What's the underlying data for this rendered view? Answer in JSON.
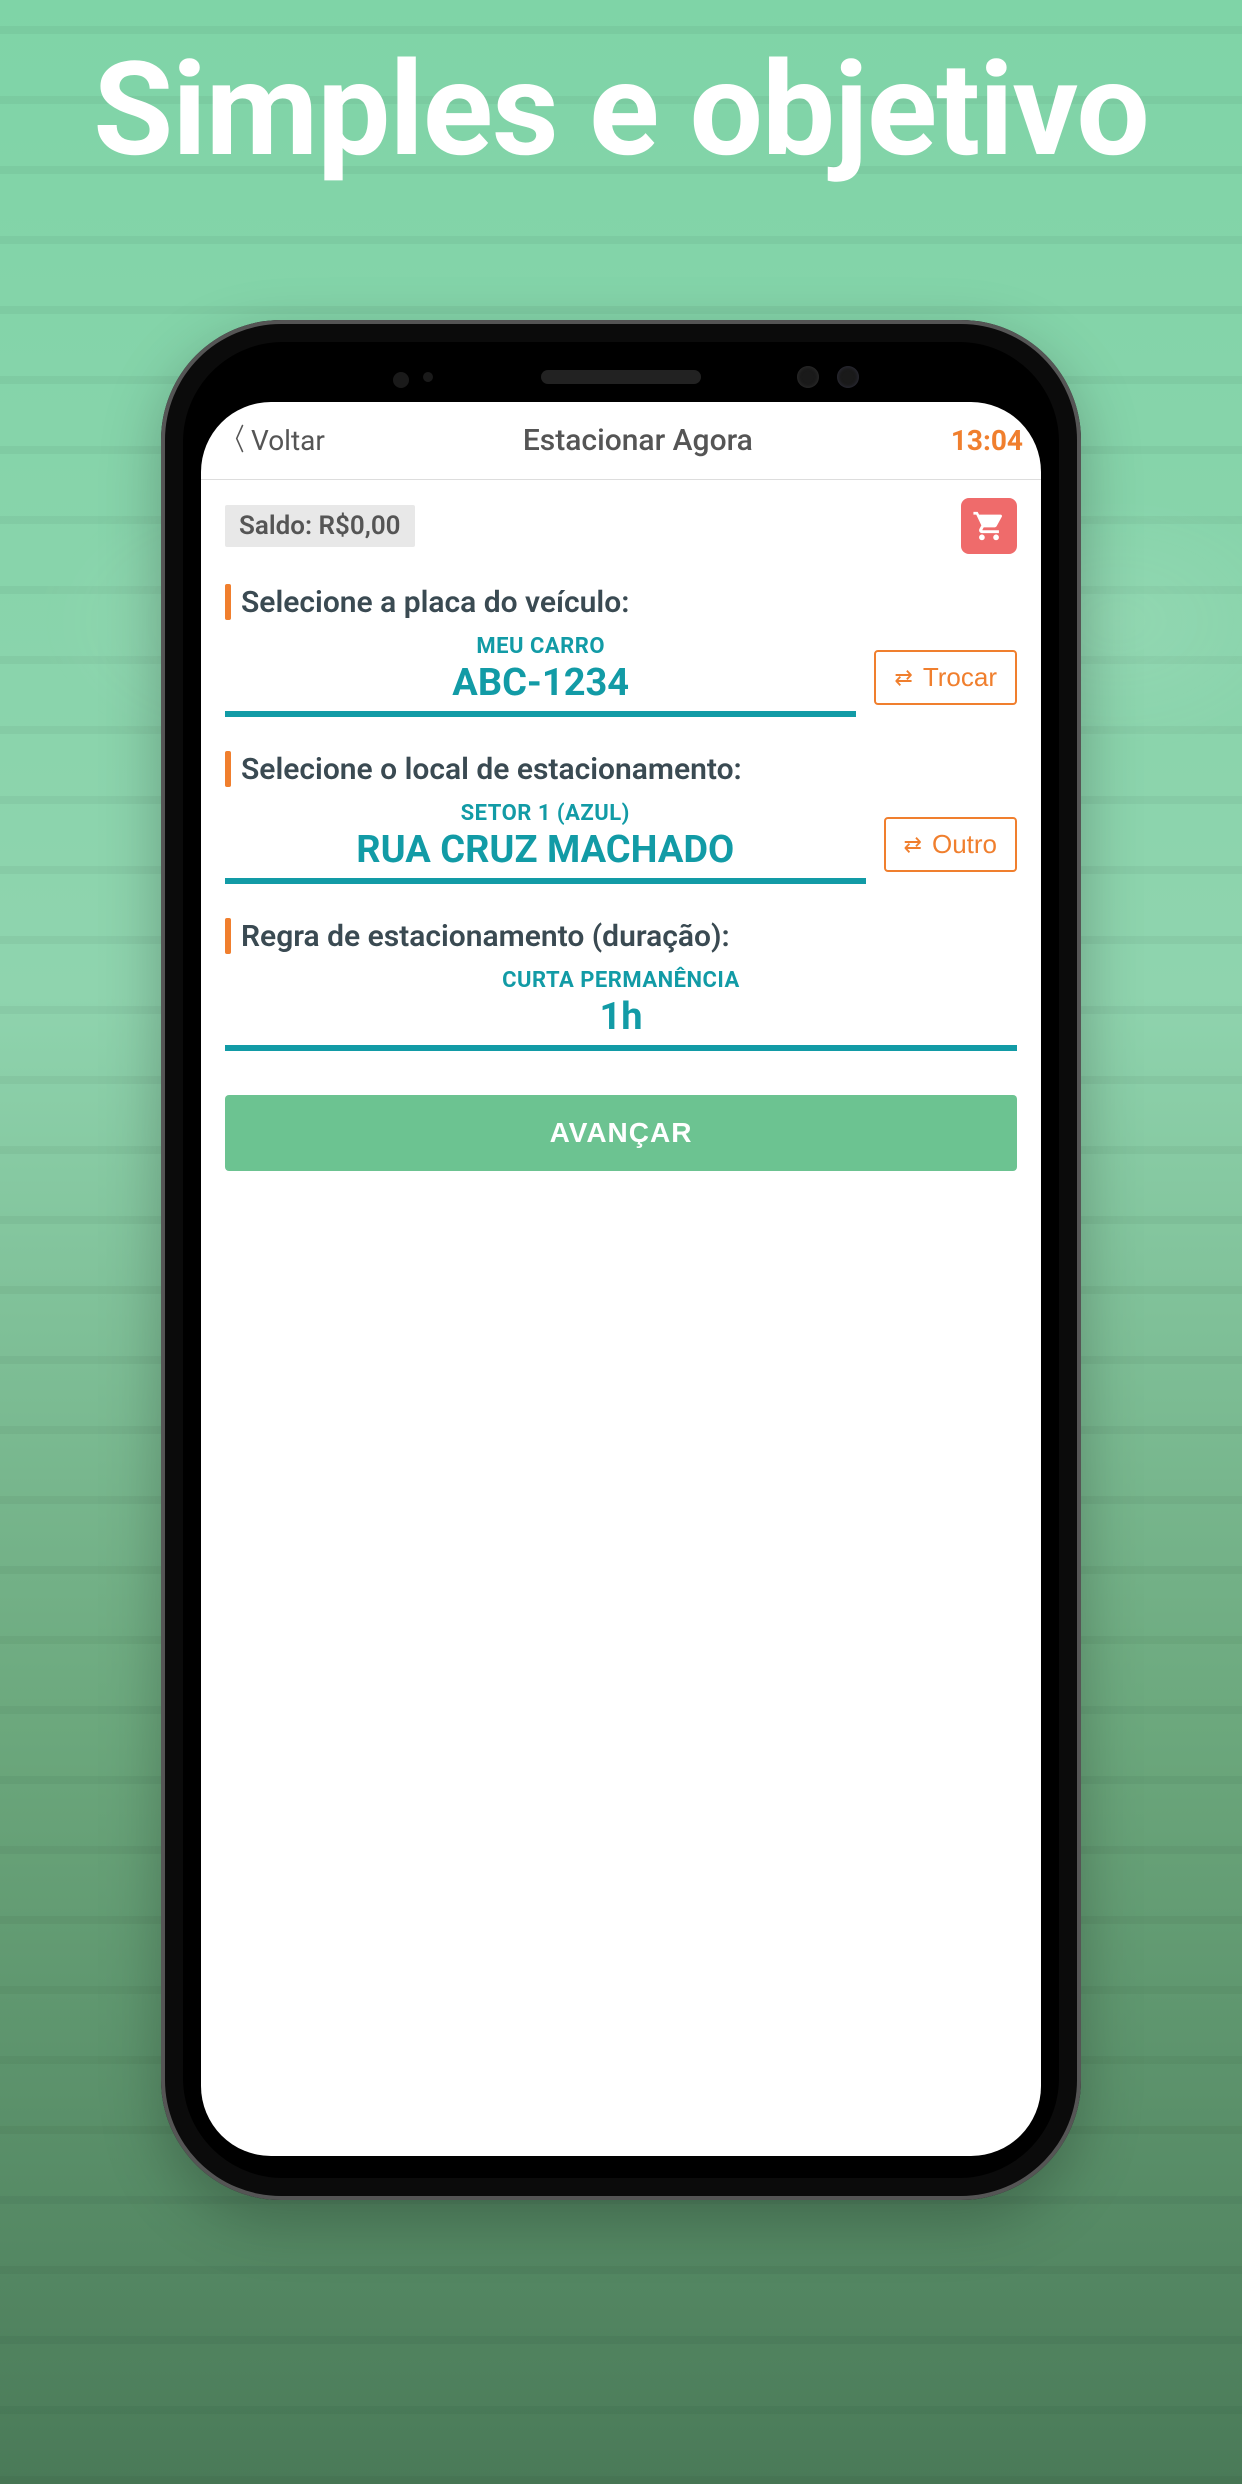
{
  "promo": {
    "headline": "Simples e objetivo"
  },
  "header": {
    "back_label": "Voltar",
    "title": "Estacionar Agora",
    "time": "13:04"
  },
  "balance": {
    "label": "Saldo: R$0,00"
  },
  "vehicle": {
    "section_label": "Selecione a placa do veículo:",
    "nickname": "MEU CARRO",
    "plate": "ABC-1234",
    "swap_label": "Trocar"
  },
  "location": {
    "section_label": "Selecione o local de estacionamento:",
    "sector": "SETOR 1 (AZUL)",
    "street": "RUA CRUZ MACHADO",
    "swap_label": "Outro"
  },
  "rule": {
    "section_label": "Regra de estacionamento (duração):",
    "type": "CURTA PERMANÊNCIA",
    "duration": "1h"
  },
  "actions": {
    "advance": "AVANÇAR"
  }
}
